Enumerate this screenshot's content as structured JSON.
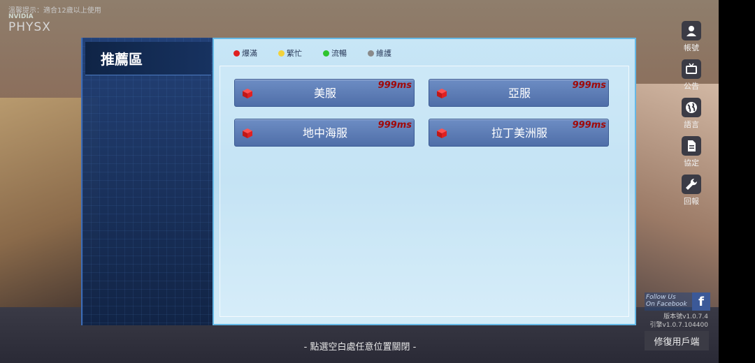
{
  "game": {
    "warning": "溫馨提示：適合12歲以上使用",
    "physx_brand": "NVIDIA",
    "physx_name": "PHYSX"
  },
  "right_menu": [
    {
      "label": "帳號",
      "icon": "account-icon"
    },
    {
      "label": "公告",
      "icon": "announcement-icon"
    },
    {
      "label": "語言",
      "icon": "globe-icon"
    },
    {
      "label": "協定",
      "icon": "document-icon"
    },
    {
      "label": "回報",
      "icon": "wrench-icon"
    }
  ],
  "facebook": {
    "line1": "Follow Us",
    "line2": "On Facebook",
    "logo": "f"
  },
  "version": {
    "line1": "版本號v1.0.7.4",
    "line2": "引擎v1.0.7.104400"
  },
  "repair_button": "修復用戶端",
  "close_hint": "- 點選空白處任意位置關閉 -",
  "sidebar": {
    "active_tab": "推薦區"
  },
  "legend": [
    {
      "label": "爆滿",
      "color": "#e02020"
    },
    {
      "label": "繁忙",
      "color": "#f2d23c"
    },
    {
      "label": "流暢",
      "color": "#2ec42e"
    },
    {
      "label": "維護",
      "color": "#8a8a8a"
    }
  ],
  "servers": [
    {
      "name": "美服",
      "ping": "999ms",
      "status": "爆滿"
    },
    {
      "name": "亞服",
      "ping": "999ms",
      "status": "爆滿"
    },
    {
      "name": "地中海服",
      "ping": "999ms",
      "status": "爆滿"
    },
    {
      "name": "拉丁美洲服",
      "ping": "999ms",
      "status": "爆滿"
    }
  ],
  "colors": {
    "panel_border": "#64b8e6",
    "button": "#5a7ab4",
    "ping": "#a00a0a"
  }
}
